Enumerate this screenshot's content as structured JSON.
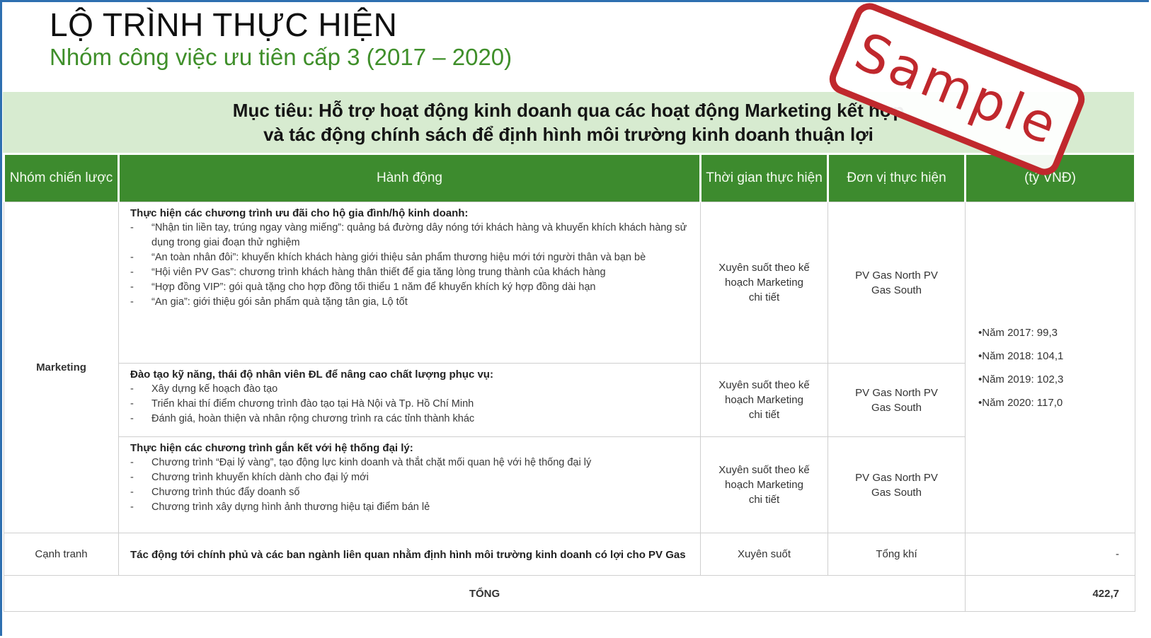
{
  "title": "LỘ TRÌNH THỰC HIỆN",
  "subtitle": "Nhóm công việc ưu tiên cấp 3 (2017 – 2020)",
  "goal": {
    "line1": "Mục tiêu: Hỗ trợ hoạt động kinh doanh qua các hoạt động Marketing kết hợp",
    "line2": "và tác động chính sách để định hình môi trường kinh doanh thuận lợi"
  },
  "headers": {
    "group": "Nhóm chiến lược",
    "action": "Hành động",
    "time": "Thời gian thực hiện",
    "unit": "Đơn vị thực hiện",
    "budget": "(tỷ VNĐ)"
  },
  "marketing": {
    "label": "Marketing",
    "rows": [
      {
        "title": "Thực hiện các chương trình ưu đãi cho hộ gia đình/hộ kinh doanh:",
        "bullets": [
          "“Nhận tin liền tay, trúng ngay vàng miếng”: quảng bá đường dây nóng tới khách hàng và khuyến khích khách hàng sử dụng trong giai đoạn thử nghiệm",
          "“An toàn nhân đôi”: khuyến khích khách hàng giới thiệu sản phẩm thương hiệu mới tới người thân và bạn bè",
          "“Hội viên PV Gas”: chương trình khách hàng thân thiết để gia tăng lòng trung thành của khách hàng",
          "“Hợp đồng VIP”: gói quà tặng cho hợp đồng tối thiểu 1 năm để khuyến khích ký hợp đồng dài hạn",
          "“An gia”: giới thiệu gói sản phẩm quà tặng tân gia, Lộ tốt"
        ],
        "time": "Xuyên suốt theo kế hoạch Marketing chi tiết",
        "unit": "PV Gas North PV Gas South"
      },
      {
        "title": "Đào tạo kỹ năng, thái độ nhân viên ĐL để nâng cao chất lượng phục vụ:",
        "bullets": [
          "Xây dựng kế hoạch đào tạo",
          "Triển khai thí điểm chương trình đào tạo tại Hà Nội và Tp. Hồ Chí Minh",
          "Đánh giá, hoàn thiện và nhân rộng chương trình ra các tỉnh thành khác"
        ],
        "time": "Xuyên suốt theo kế hoạch Marketing chi tiết",
        "unit": "PV Gas North PV Gas South"
      },
      {
        "title": "Thực hiện các chương trình gắn kết với hệ thống đại lý:",
        "bullets": [
          "Chương trình “Đại lý vàng”, tạo động lực kinh doanh và thắt chặt mối quan hệ với hệ thống đại lý",
          "Chương trình khuyến khích dành cho đại lý mới",
          "Chương trình thúc đẩy doanh số",
          "Chương trình xây dựng hình ảnh thương hiệu tại điểm bán lẻ"
        ],
        "time": "Xuyên suốt theo kế hoạch Marketing chi tiết",
        "unit": "PV Gas North PV Gas South"
      }
    ],
    "budget": [
      "•Năm 2017: 99,3",
      "•Năm 2018: 104,1",
      "•Năm 2019: 102,3",
      "•Năm 2020: 117,0"
    ]
  },
  "competition": {
    "label": "Cạnh tranh",
    "action": "Tác động tới chính phủ và các ban ngành liên quan nhằm định hình môi trường kinh doanh có lợi cho PV Gas",
    "time": "Xuyên suốt",
    "unit": "Tổng khí",
    "budget": "-"
  },
  "total": {
    "label": "TỔNG",
    "value": "422,7"
  },
  "stamp": "Sample",
  "colors": {
    "header_green": "#3d8b2e",
    "goal_bg": "#d7ebd0",
    "subtitle_green": "#3f8f2a",
    "stamp_red": "#c0282d"
  }
}
